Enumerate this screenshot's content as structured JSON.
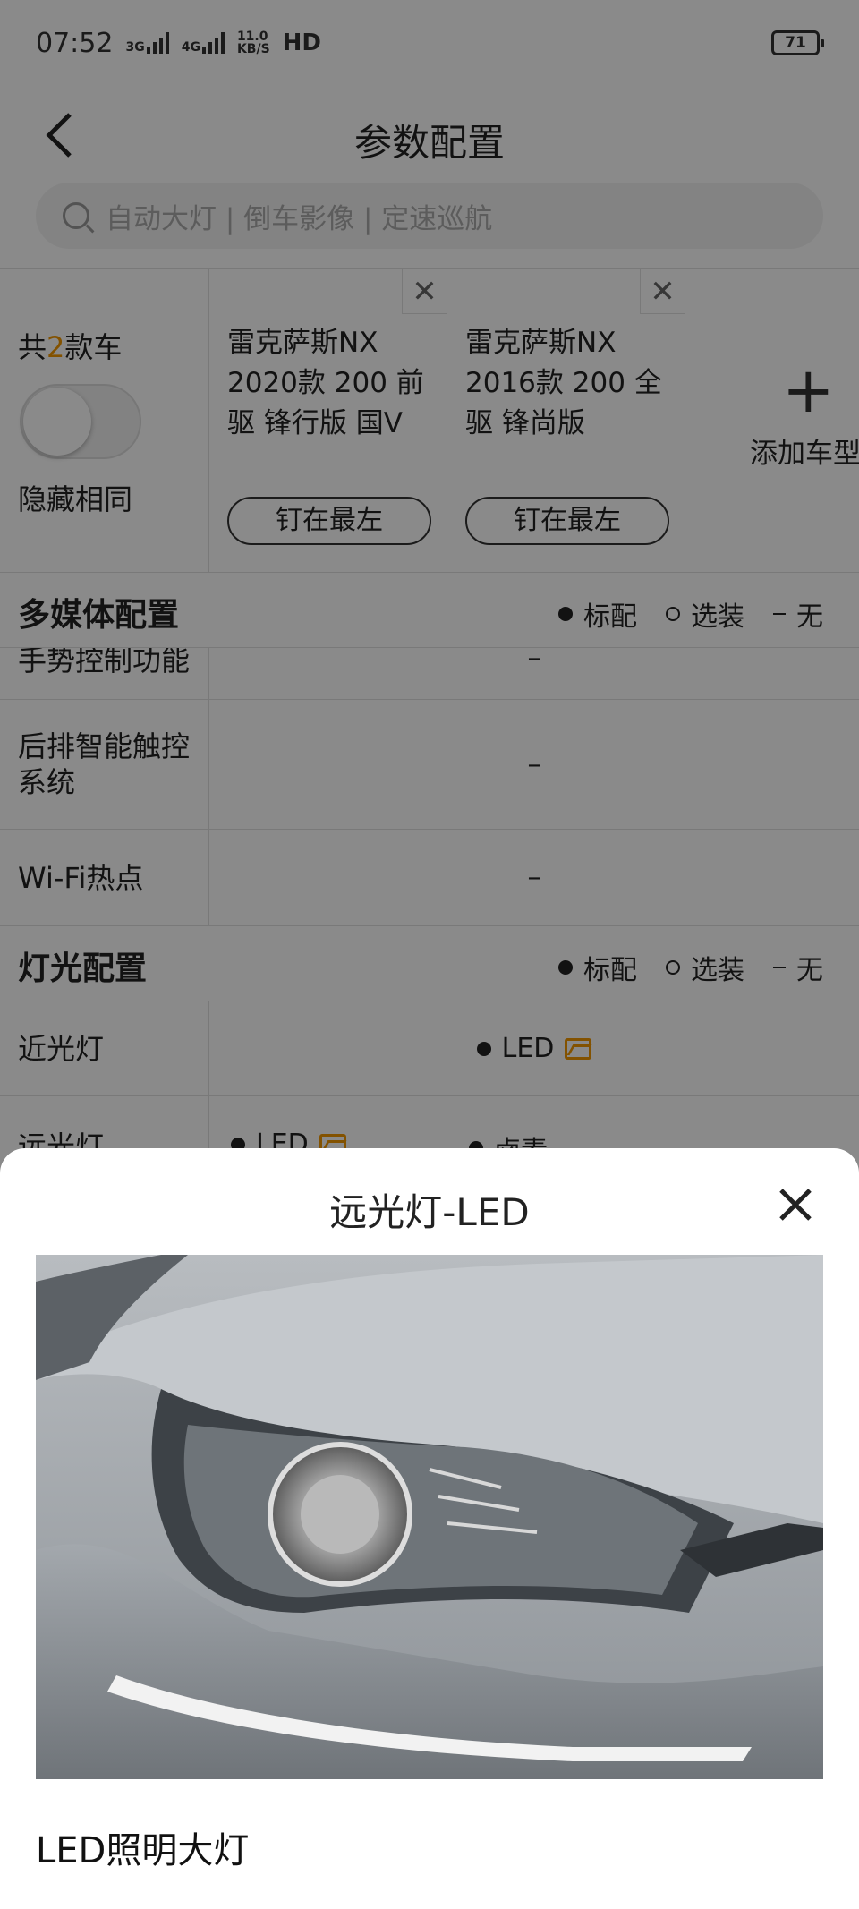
{
  "status_bar": {
    "time": "07:52",
    "network1": "3G",
    "network2": "4G",
    "speed_value": "11.0",
    "speed_unit": "KB/S",
    "hd": "HD",
    "battery": "71"
  },
  "header": {
    "back_icon": "chevron-left-icon",
    "title": "参数配置"
  },
  "search": {
    "placeholder": "自动大灯 | 倒车影像 | 定速巡航"
  },
  "compare": {
    "count_prefix": "共",
    "count_num": "2",
    "count_suffix": "款车",
    "hide_same_label": "隐藏相同",
    "hide_same_on": false,
    "cars": [
      {
        "name": "雷克萨斯NX 2020款 200 前驱 锋行版 国V",
        "pin_label": "钉在最左"
      },
      {
        "name": "雷克萨斯NX 2016款 200 全驱 锋尚版",
        "pin_label": "钉在最左"
      }
    ],
    "add_plus": "+",
    "add_label": "添加车型"
  },
  "legend": {
    "standard": "标配",
    "optional": "选装",
    "none": "无"
  },
  "sections": {
    "multimedia": {
      "title": "多媒体配置",
      "rows": [
        {
          "label": "手势控制功能",
          "value": "–"
        },
        {
          "label": "后排智能触控系统",
          "value": "–"
        },
        {
          "label": "Wi-Fi热点",
          "value": "–"
        }
      ]
    },
    "lighting": {
      "title": "灯光配置",
      "rows": [
        {
          "label": "近光灯",
          "value": "LED"
        },
        {
          "label": "远光灯",
          "values": [
            "LED",
            "卤素"
          ]
        }
      ]
    }
  },
  "sheet": {
    "title": "远光灯-LED",
    "close_icon": "close-icon",
    "caption": "LED照明大灯"
  },
  "colors": {
    "accent": "#f39800",
    "overlay": "rgba(0,0,0,0.46)"
  }
}
